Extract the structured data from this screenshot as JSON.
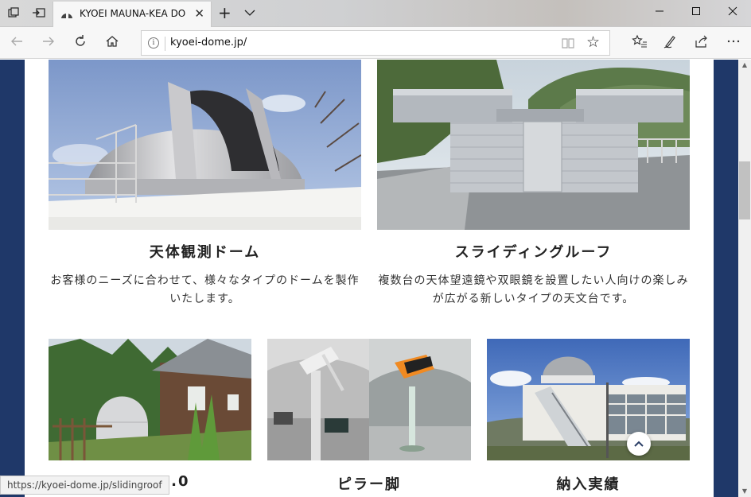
{
  "browser": {
    "tab_title": "KYOEI MAUNA-KEA DO",
    "new_tab_label": "+",
    "url": "kyoei-dome.jp/",
    "status_url": "https://kyoei-dome.jp/slidingroof"
  },
  "cards_top": [
    {
      "title": "天体観測ドーム",
      "description": "お客様のニーズに合わせて、様々なタイプのドームを製作いたします。"
    },
    {
      "title": "スライディングルーフ",
      "description": "複数台の天体望遠鏡や双眼鏡を設置したい人向けの楽しみが広がる新しいタイプの天文台です。"
    }
  ],
  "cards_bottom": [
    {
      "title": "GFRP2.0"
    },
    {
      "title": "ピラー脚"
    },
    {
      "title": "納入実績"
    }
  ],
  "colors": {
    "page_background": "#1f3869",
    "content_background": "#ffffff"
  }
}
